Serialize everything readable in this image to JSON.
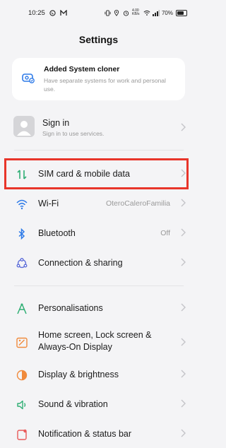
{
  "status_bar": {
    "time": "10:25",
    "battery_percent": "70%",
    "left_icons": [
      "whatsapp-icon",
      "app-notification-icon"
    ],
    "right_icons": [
      "vibrate-icon",
      "location-icon",
      "alarm-icon",
      "data-speed-icon",
      "wifi-icon",
      "signal-icon",
      "battery-icon"
    ],
    "data_speed": "4.00 KB/s"
  },
  "header": {
    "title": "Settings"
  },
  "cloner_card": {
    "title": "Added System cloner",
    "subtitle": "Have separate systems for work and personal use.",
    "icon": "system-cloner-icon"
  },
  "account": {
    "title": "Sign in",
    "subtitle": "Sign in to use services.",
    "icon": "avatar-placeholder"
  },
  "settings": [
    {
      "key": "sim",
      "label": "SIM card & mobile data",
      "value": "",
      "icon": "sim-data-icon",
      "color": "#2fae74",
      "highlighted": true
    },
    {
      "key": "wifi",
      "label": "Wi-Fi",
      "value": "OteroCaleroFamilia",
      "icon": "wifi-icon",
      "color": "#2f7be8"
    },
    {
      "key": "bluetooth",
      "label": "Bluetooth",
      "value": "Off",
      "icon": "bluetooth-icon",
      "color": "#2f7be8"
    },
    {
      "key": "connection",
      "label": "Connection & sharing",
      "value": "",
      "icon": "connection-icon",
      "color": "#5b6bd8"
    },
    {
      "key": "personalisations",
      "label": "Personalisations",
      "value": "",
      "icon": "personalisation-icon",
      "color": "#2fae74"
    },
    {
      "key": "home",
      "label_line1": "Home screen, Lock screen &",
      "label_line2": "Always-On Display",
      "value": "",
      "icon": "home-screen-icon",
      "color": "#f08a3c"
    },
    {
      "key": "display",
      "label": "Display & brightness",
      "value": "",
      "icon": "brightness-icon",
      "color": "#f08a3c"
    },
    {
      "key": "sound",
      "label": "Sound & vibration",
      "value": "",
      "icon": "sound-icon",
      "color": "#2fae74"
    },
    {
      "key": "notification",
      "label": "Notification & status bar",
      "value": "",
      "icon": "notification-icon",
      "color": "#e85a5a"
    }
  ],
  "colors": {
    "highlight_border": "#e8352a",
    "background": "#f4f4f6",
    "secondary_text": "#999999"
  }
}
